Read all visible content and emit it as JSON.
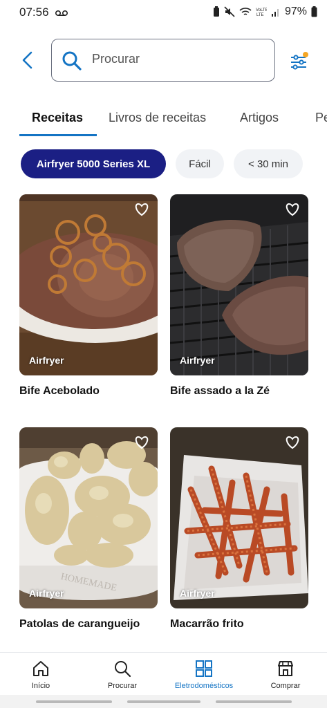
{
  "status": {
    "time": "07:56",
    "battery": "97%"
  },
  "search": {
    "placeholder": "Procurar"
  },
  "tabs": [
    {
      "label": "Receitas"
    },
    {
      "label": "Livros de receitas"
    },
    {
      "label": "Artigos"
    },
    {
      "label": "Pe"
    }
  ],
  "chips": [
    {
      "label": "Airfryer 5000 Series XL"
    },
    {
      "label": "Fácil"
    },
    {
      "label": "< 30 min"
    }
  ],
  "recipes": [
    {
      "title": "Bife Acebolado",
      "tag": "Airfryer"
    },
    {
      "title": "Bife assado a la Zé",
      "tag": "Airfryer"
    },
    {
      "title": "Patolas de carangueijo",
      "tag": "Airfryer"
    },
    {
      "title": "Macarrão frito",
      "tag": "Airfryer"
    }
  ],
  "nav": [
    {
      "label": "Início",
      "icon": "home-icon"
    },
    {
      "label": "Procurar",
      "icon": "search-icon"
    },
    {
      "label": "Eletrodomésticos",
      "icon": "appliances-icon"
    },
    {
      "label": "Comprar",
      "icon": "store-icon"
    }
  ],
  "colors": {
    "accent": "#1474c4",
    "chip_selected": "#1b1f84",
    "filter_dot": "#f5a623"
  }
}
